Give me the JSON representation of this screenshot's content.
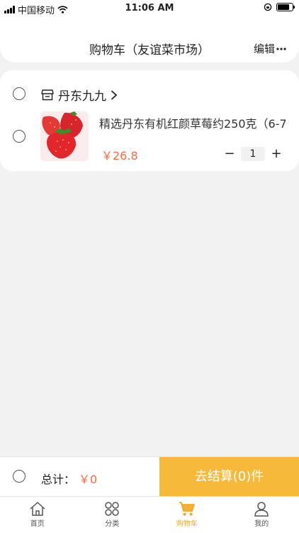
{
  "status_bar": {
    "carrier": "中国移动",
    "time": "11:06 AM",
    "battery_level": 0.9
  },
  "header": {
    "title": "购物车（友谊菜市场）",
    "edit_label": "编辑"
  },
  "cart": {
    "shop_name": "丹东九九",
    "items": [
      {
        "name": "精选丹东有机红颜草莓约250克（6-7",
        "price": "￥26.8",
        "quantity": "1"
      }
    ],
    "minus_label": "−",
    "plus_label": "+"
  },
  "checkout": {
    "total_label": "总计：",
    "total_value": "￥0",
    "button_label": "去结算(0)件"
  },
  "tabs": [
    {
      "label": "首页",
      "icon": "home-icon",
      "active": false
    },
    {
      "label": "分类",
      "icon": "category-icon",
      "active": false
    },
    {
      "label": "购物车",
      "icon": "cart-icon",
      "active": true
    },
    {
      "label": "我的",
      "icon": "profile-icon",
      "active": false
    }
  ],
  "colors": {
    "accent": "#f7b93a",
    "price": "#f26d3d",
    "active_tab": "#f5a623"
  }
}
